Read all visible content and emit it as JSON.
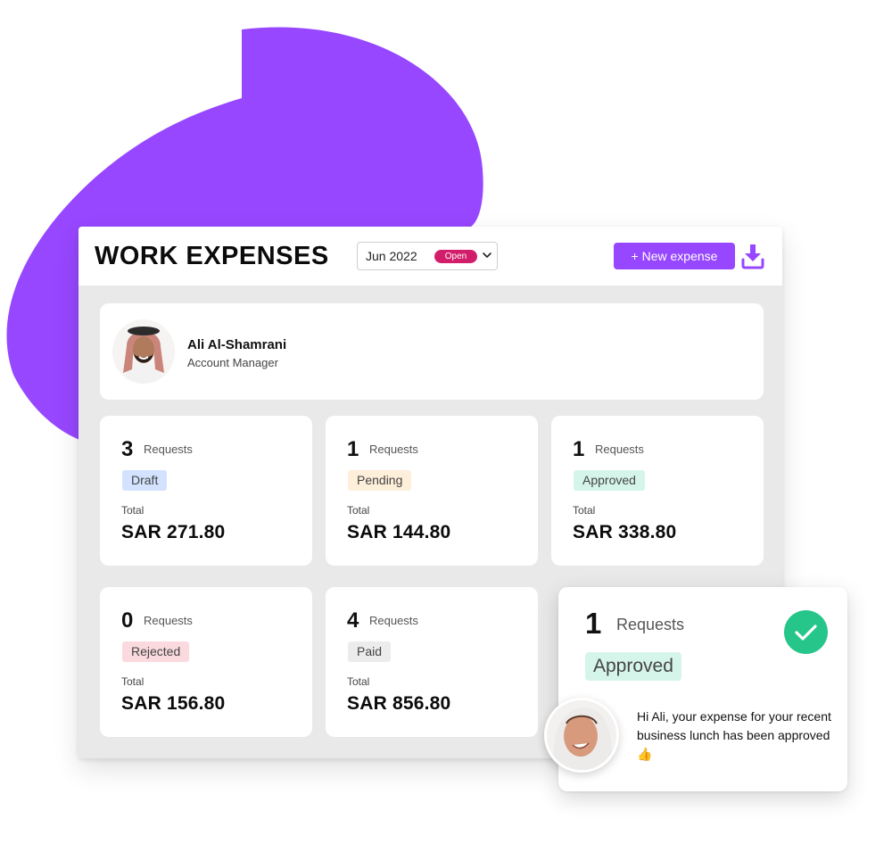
{
  "header": {
    "title": "WORK EXPENSES",
    "period": "Jun 2022",
    "period_status": "Open",
    "new_button": "+ New expense",
    "download_icon": "download-icon"
  },
  "profile": {
    "name": "Ali Al-Shamrani",
    "role": "Account Manager",
    "avatar": "man-in-shemagh-avatar"
  },
  "stats": [
    {
      "count": "3",
      "requests_label": "Requests",
      "status": "Draft",
      "total_label": "Total",
      "total": "SAR 271.80",
      "tag_bg": "#d3e2fe"
    },
    {
      "count": "1",
      "requests_label": "Requests",
      "status": "Pending",
      "total_label": "Total",
      "total": "SAR 144.80",
      "tag_bg": "#fdefd9"
    },
    {
      "count": "1",
      "requests_label": "Requests",
      "status": "Approved",
      "total_label": "Total",
      "total": "SAR 338.80",
      "tag_bg": "#d6f5ea"
    },
    {
      "count": "0",
      "requests_label": "Requests",
      "status": "Rejected",
      "total_label": "Total",
      "total": "SAR 156.80",
      "tag_bg": "#fadadf"
    },
    {
      "count": "4",
      "requests_label": "Requests",
      "status": "Paid",
      "total_label": "Total",
      "total": "SAR 856.80",
      "tag_bg": "#ececec"
    }
  ],
  "notification": {
    "count": "1",
    "requests_label": "Requests",
    "status": "Approved",
    "message": "Hi Ali, your expense for your recent business lunch has been approved 👍",
    "icon": "check-circle-icon",
    "avatar": "woman-in-hijab-avatar"
  },
  "colors": {
    "brand_purple": "#9747ff",
    "open_badge": "#d21e6a",
    "approved_green": "#26c68a"
  }
}
